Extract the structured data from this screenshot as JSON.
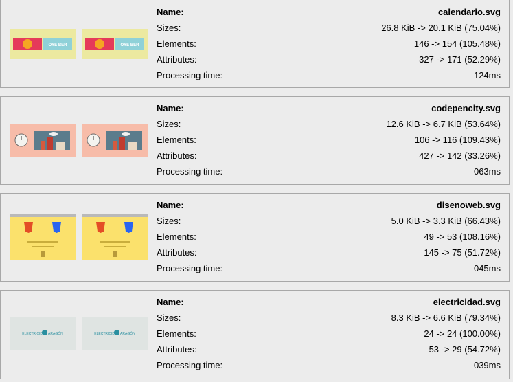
{
  "labels": {
    "name": "Name:",
    "sizes": "Sizes:",
    "elements": "Elements:",
    "attributes": "Attributes:",
    "processing": "Processing time:"
  },
  "results": [
    {
      "name": "calendario.svg",
      "sizes": "26.8 KiB -> 20.1 KiB (75.04%)",
      "elements": "146 -> 154 (105.48%)",
      "attributes": "327 -> 171 (52.29%)",
      "processing": "124ms",
      "thumb_bg": "#ece9a0",
      "thumb_text": "OYE BER"
    },
    {
      "name": "codepencity.svg",
      "sizes": "12.6 KiB -> 6.7 KiB (53.64%)",
      "elements": "106 -> 116 (109.43%)",
      "attributes": "427 -> 142 (33.26%)",
      "processing": "063ms",
      "thumb_bg": "#f7bca9"
    },
    {
      "name": "disenoweb.svg",
      "sizes": "5.0 KiB -> 3.3 KiB (66.43%)",
      "elements": "49 -> 53 (108.16%)",
      "attributes": "145 -> 75 (51.72%)",
      "processing": "045ms",
      "thumb_bg": "#fbe16c",
      "thumb_text": "HTML CSS"
    },
    {
      "name": "electricidad.svg",
      "sizes": "8.3 KiB -> 6.6 KiB (79.34%)",
      "elements": "24 -> 24 (100.00%)",
      "attributes": "53 -> 29 (54.72%)",
      "processing": "039ms",
      "thumb_bg": "#dfe4e2",
      "thumb_text": "ELECTRICIDAD ARAGÓN"
    }
  ]
}
